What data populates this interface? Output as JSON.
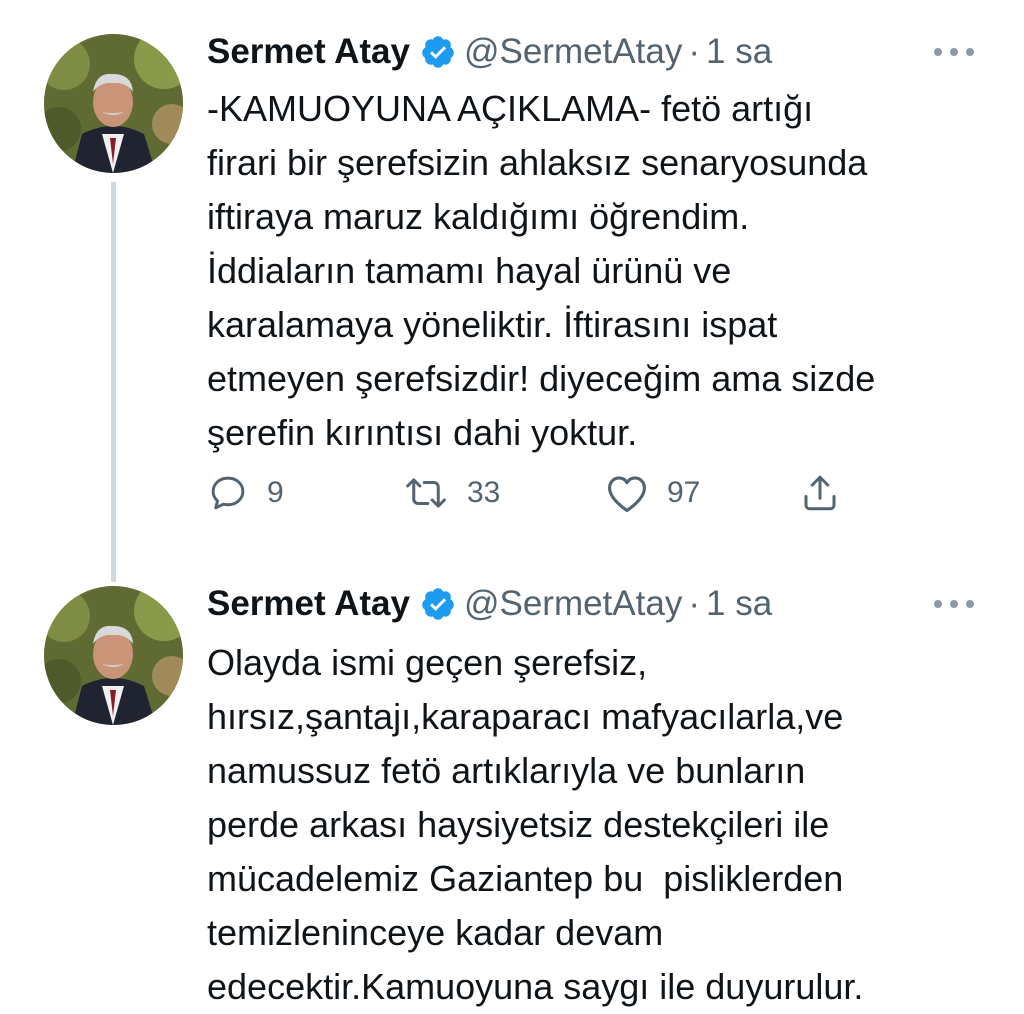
{
  "tweets": [
    {
      "author_name": "Sermet Atay",
      "handle": "@SermetAtay",
      "separator": "·",
      "time": "1 sa",
      "lines": [
        "-KAMUOYUNA AÇIKLAMA- fetö artığı",
        "firari bir şerefsizin ahlaksız senaryosunda",
        "iftiraya maruz kaldığımı öğrendim.",
        "İddiaların tamamı hayal ürünü ve",
        "karalamaya yöneliktir. İftirasını ispat",
        "etmeyen şerefsizdir! diyeceğim ama sizde",
        "şerefin kırıntısı dahi yoktur."
      ],
      "replies": "9",
      "retweets": "33",
      "likes": "97"
    },
    {
      "author_name": "Sermet Atay",
      "handle": "@SermetAtay",
      "separator": "·",
      "time": "1 sa",
      "lines": [
        "Olayda ismi geçen şerefsiz,",
        "hırsız,şantajı,karaparacı mafyacılarla,ve",
        "namussuz fetö artıklarıyla ve bunların",
        "perde arkası haysiyetsiz destekçileri ile",
        "mücadelemiz Gaziantep bu  pisliklerden",
        "temizleninceye kadar devam",
        "edecektir.Kamuoyuna saygı ile duyurulur."
      ]
    }
  ],
  "icons": {
    "verified": "verified-badge-icon",
    "more": "more-options-icon",
    "reply": "reply-icon",
    "retweet": "retweet-icon",
    "like": "like-icon",
    "share": "share-icon"
  },
  "colors": {
    "text": "#0f1419",
    "secondary": "#536471",
    "verified_blue": "#1d9bf0",
    "thread_line": "#cfd9de"
  }
}
